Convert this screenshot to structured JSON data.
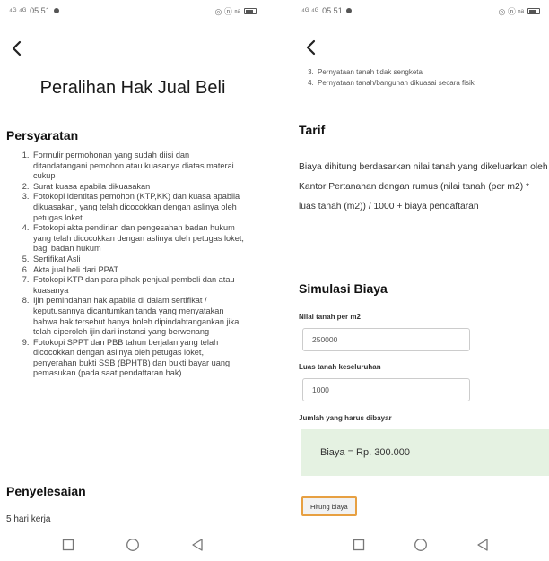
{
  "left": {
    "status": {
      "network": "⁴ᴳ ⁴ᴳ",
      "time": "05.51",
      "right_icons": "◎ ⓝ ⁿᵃ"
    },
    "title": "Peralihan Hak Jual Beli",
    "requirements_title": "Persyaratan",
    "requirements": [
      "Formulir permohonan yang sudah diisi dan ditandatangani pemohon atau kuasanya diatas materai cukup",
      "Surat kuasa apabila dikuasakan",
      "Fotokopi identitas pemohon (KTP,KK) dan kuasa apabila dikuasakan, yang telah dicocokkan dengan aslinya oleh petugas loket",
      "Fotokopi akta pendirian dan pengesahan badan hukum yang telah dicocokkan dengan aslinya oleh petugas loket, bagi badan hukum",
      "Sertifikat Asli",
      "Akta jual beli dari PPAT",
      "Fotokopi KTP dan para pihak penjual-pembeli dan atau kuasanya",
      "Ijin pemindahan hak apabila di dalam sertifikat / keputusannya dicantumkan tanda yang menyatakan bahwa hak tersebut hanya boleh dipindahtangankan jika telah diperoleh ijin dari instansi yang berwenang",
      "Fotokopi SPPT dan PBB tahun berjalan yang telah dicocokkan dengan aslinya oleh petugas loket, penyerahan bukti SSB (BPHTB) dan bukti bayar uang pemasukan (pada saat pendaftaran hak)"
    ],
    "completion_title": "Penyelesaian",
    "completion_value": "5 hari kerja"
  },
  "right": {
    "status": {
      "network": "⁴ᴳ ⁴ᴳ",
      "time": "05.51",
      "right_icons": "◎ ⓝ ⁿᵃ"
    },
    "requirements_cont": [
      {
        "num": 3,
        "text": "Pernyataan tanah tidak sengketa"
      },
      {
        "num": 4,
        "text": "Pernyataan tanah/bangunan dikuasai secara fisik"
      }
    ],
    "tarif_title": "Tarif",
    "tarif_desc": "Biaya dihitung berdasarkan nilai tanah yang dikeluarkan oleh Kantor Pertanahan dengan rumus (nilai tanah (per m2) * luas tanah (m2)) / 1000 + biaya pendaftaran",
    "simulation_title": "Simulasi Biaya",
    "land_value_label": "Nilai tanah per m2",
    "land_value": "250000",
    "land_area_label": "Luas tanah keseluruhan",
    "land_area": "1000",
    "total_label": "Jumlah yang harus dibayar",
    "total_value": "Biaya = Rp. 300.000",
    "calc_button": "Hitung biaya"
  },
  "colors": {
    "result_bg": "#e5f2e2",
    "button_border": "#e7a042"
  }
}
